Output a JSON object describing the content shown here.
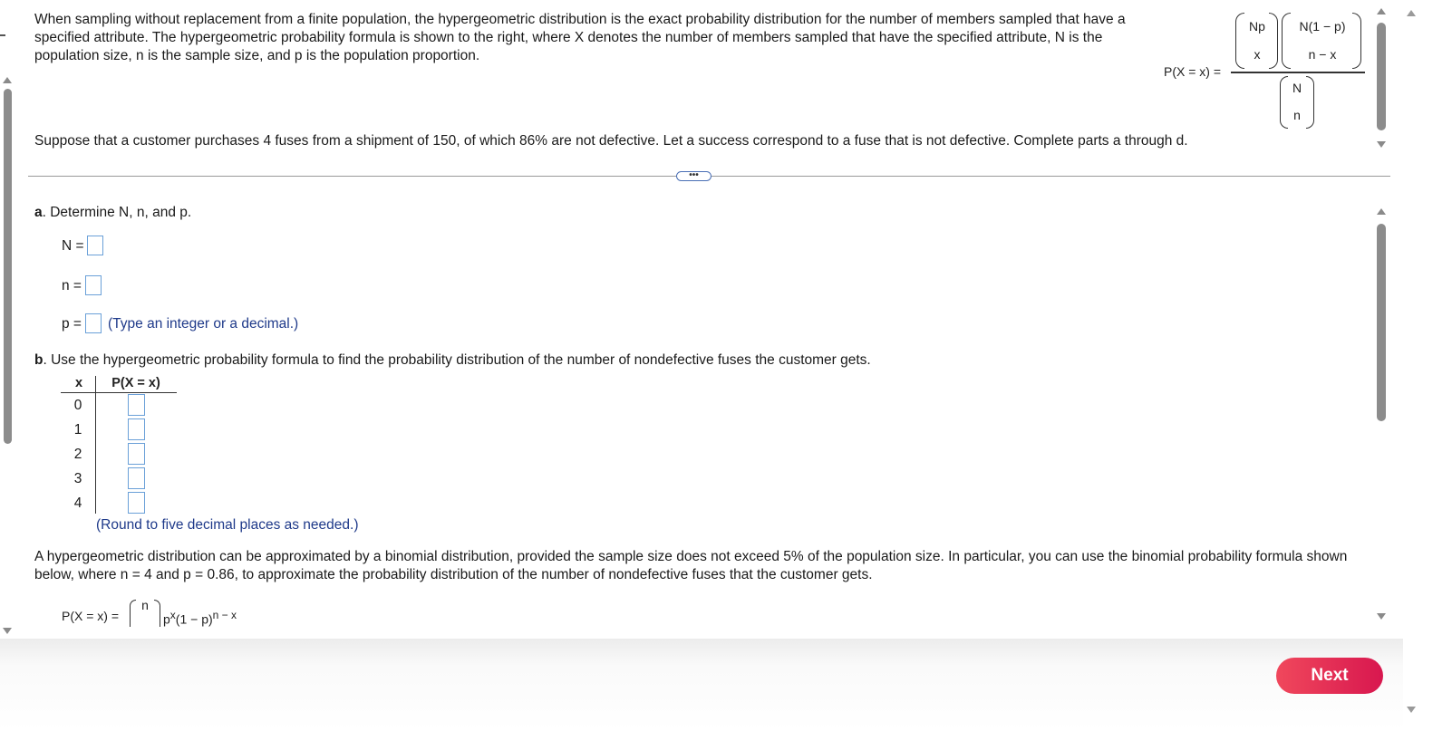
{
  "top": {
    "intro": "When sampling without replacement from a finite population, the hypergeometric distribution is the exact probability distribution for the number of members sampled that have a specified attribute. The hypergeometric probability formula is shown to the right, where X denotes the number of members sampled that have the specified attribute, N is the population size, n is the sample size, and p is the population proportion.",
    "problem": "Suppose that a customer purchases 4 fuses from a shipment of 150, of which 86% are not defective. Let a success correspond to a fuse that is not defective. Complete parts a through d.",
    "formula": {
      "lhs": "P(X = x) =",
      "num1_top": "Np",
      "num1_bottom": "x",
      "num2_top": "N(1 − p)",
      "num2_bottom": "n − x",
      "den_top": "N",
      "den_bottom": "n"
    }
  },
  "divider": {
    "handle": "•••"
  },
  "part_a": {
    "letter": "a",
    "text": ". Determine N, n, and p.",
    "N_label": "N =",
    "n_label": "n =",
    "p_label": "p =",
    "p_hint": "(Type an integer or a decimal.)"
  },
  "part_b": {
    "letter": "b",
    "text": ". Use the hypergeometric probability formula to find the probability distribution of the number of nondefective fuses the customer gets.",
    "col_x": "x",
    "col_p": "P(X = x)",
    "rows": [
      "0",
      "1",
      "2",
      "3",
      "4"
    ],
    "hint": "(Round to five decimal places as needed.)"
  },
  "binomial": {
    "text": "A hypergeometric distribution can be approximated by a binomial distribution, provided the sample size does not exceed 5% of the population size. In particular, you can use the binomial probability formula shown below, where n = 4 and p = 0.86, to approximate the probability distribution of the number of nondefective fuses that the customer gets.",
    "lhs": "P(X = x) =",
    "choose_top": "n",
    "rhs_p": "p",
    "rhs_x": "x",
    "rhs_mid": "(1 − p)",
    "rhs_exp": "n − x"
  },
  "footer": {
    "next_label": "Next"
  },
  "colors": {
    "accent": "#e0284f",
    "navy": "#1f3a8a",
    "box_border": "#6aa0d8"
  }
}
